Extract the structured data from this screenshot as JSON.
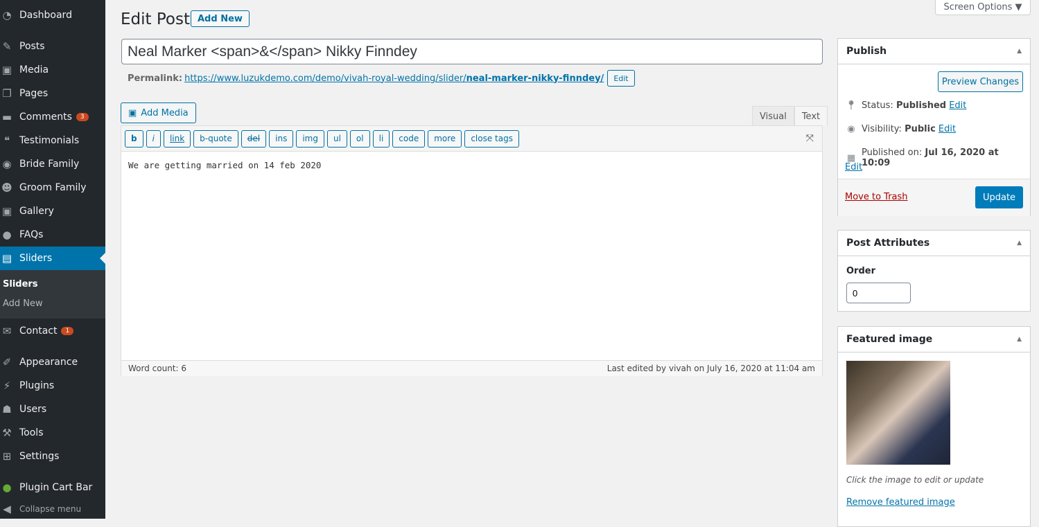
{
  "sidebar": {
    "items": [
      {
        "label": "Dashboard",
        "icon": "dashboard-icon"
      },
      {
        "label": "Posts",
        "icon": "pin-icon"
      },
      {
        "label": "Media",
        "icon": "media-icon"
      },
      {
        "label": "Pages",
        "icon": "pages-icon"
      },
      {
        "label": "Comments",
        "icon": "comment-icon",
        "badge": "3"
      },
      {
        "label": "Testimonials",
        "icon": "testimonial-icon"
      },
      {
        "label": "Bride Family",
        "icon": "user-circle-icon"
      },
      {
        "label": "Groom Family",
        "icon": "groups-icon"
      },
      {
        "label": "Gallery",
        "icon": "media-icon"
      },
      {
        "label": "FAQs",
        "icon": "chat-icon"
      },
      {
        "label": "Sliders",
        "icon": "slides-icon"
      },
      {
        "label": "Contact",
        "icon": "mail-icon",
        "badge": "1"
      },
      {
        "label": "Appearance",
        "icon": "brush-icon"
      },
      {
        "label": "Plugins",
        "icon": "plugin-icon"
      },
      {
        "label": "Users",
        "icon": "users-icon"
      },
      {
        "label": "Tools",
        "icon": "wrench-icon"
      },
      {
        "label": "Settings",
        "icon": "settings-icon"
      },
      {
        "label": "Plugin Cart Bar",
        "icon": "leaf-icon"
      },
      {
        "label": "Collapse menu",
        "icon": "collapse-icon"
      }
    ],
    "submenu": [
      "Sliders",
      "Add New"
    ]
  },
  "header": {
    "title": "Edit Post",
    "add_new": "Add New",
    "screen_options": "Screen Options ▼"
  },
  "post": {
    "title": "Neal Marker <span>&</span> Nikky Finndey",
    "permalink_label": "Permalink:",
    "permalink_base": "https://www.luzukdemo.com/demo/vivah-royal-wedding/slider/",
    "permalink_slug": "neal-marker-nikky-finndey/",
    "permalink_edit": "Edit",
    "add_media": "Add Media",
    "tabs": [
      "Visual",
      "Text"
    ],
    "quicktags": [
      "b",
      "i",
      "link",
      "b-quote",
      "del",
      "ins",
      "img",
      "ul",
      "ol",
      "li",
      "code",
      "more",
      "close tags"
    ],
    "content": "We are getting married on 14 feb 2020",
    "word_count": "Word count: 6",
    "last_edited": "Last edited by vivah on July 16, 2020 at 11:04 am"
  },
  "publish": {
    "title": "Publish",
    "preview": "Preview Changes",
    "status_label": "Status:",
    "status": "Published",
    "visibility_label": "Visibility:",
    "visibility": "Public",
    "published_label": "Published on:",
    "published": "Jul 16, 2020 at 10:09",
    "edit": "Edit",
    "trash": "Move to Trash",
    "update": "Update"
  },
  "attributes": {
    "title": "Post Attributes",
    "order_label": "Order",
    "order": "0"
  },
  "featured": {
    "title": "Featured image",
    "caption": "Click the image to edit or update",
    "remove": "Remove featured image"
  },
  "colors": {
    "accent": "#0073aa",
    "sidebar": "#23282d",
    "badge": "#ca4a1f",
    "trash": "#a00"
  }
}
